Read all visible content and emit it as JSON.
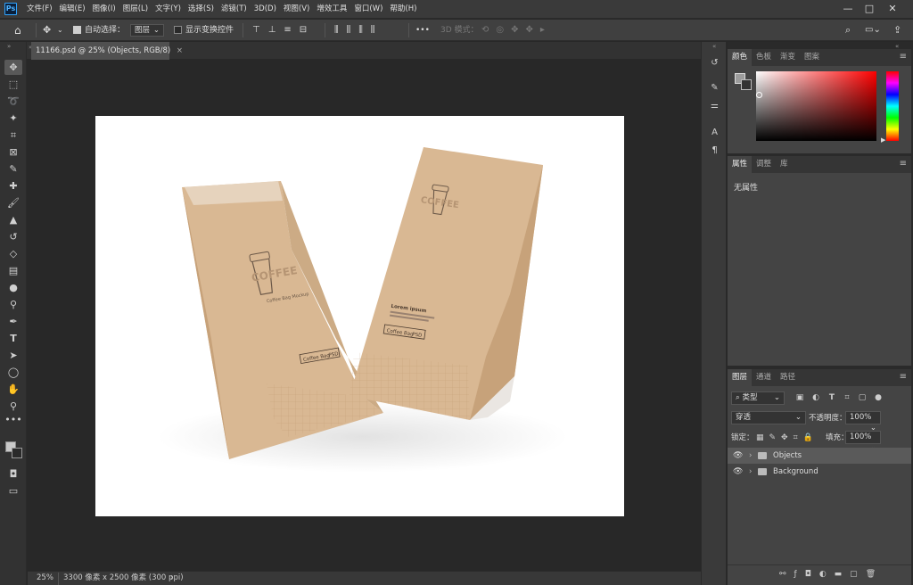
{
  "app": {
    "logo": "Ps"
  },
  "menu": [
    "文件(F)",
    "编辑(E)",
    "图像(I)",
    "图层(L)",
    "文字(Y)",
    "选择(S)",
    "滤镜(T)",
    "3D(D)",
    "视图(V)",
    "增效工具",
    "窗口(W)",
    "帮助(H)"
  ],
  "window_controls": {
    "minimize": "—",
    "maximize": "□",
    "close": "✕"
  },
  "options": {
    "auto_select_label": "自动选择：",
    "auto_select_target": "图层",
    "show_transform_label": "显示变换控件",
    "mode_3d_label": "3D 模式：",
    "more": "•••"
  },
  "document_tab": {
    "title": "11166.psd @ 25% (Objects, RGB/8)",
    "close": "×"
  },
  "status": {
    "zoom": "25%",
    "info": "3300 像素 x 2500 像素 (300 ppi)",
    "arrow": "›"
  },
  "color_panel": {
    "tabs": [
      "颜色",
      "色板",
      "渐变",
      "图案"
    ],
    "active": 0
  },
  "properties_panel": {
    "tabs": [
      "属性",
      "调整",
      "库"
    ],
    "active": 0,
    "body": "无属性"
  },
  "layers_panel": {
    "tabs": [
      "图层",
      "通道",
      "路径"
    ],
    "active": 0,
    "filter_kind": "类型",
    "blend_mode": "穿透",
    "opacity_label": "不透明度：",
    "opacity_value": "100%",
    "lock_label": "锁定：",
    "fill_label": "填充：",
    "fill_value": "100%",
    "layers": [
      {
        "name": "Objects",
        "selected": true
      },
      {
        "name": "Background",
        "selected": false
      }
    ]
  },
  "artwork": {
    "bag_left": {
      "brand": "COFFEE",
      "sub": "Coffee Bag Mockup",
      "tag": "Coffee Bag",
      "badge": "PSD"
    },
    "bag_right": {
      "brand": "COFFEE",
      "heading": "Lorem ipsum",
      "tag": "Coffee Bag",
      "badge": "PSD"
    }
  },
  "colors": {
    "kraft": "#d9b893",
    "kraft_dark": "#c7a27a",
    "ui_bg": "#282828",
    "panel": "#444444",
    "accent": "#2fa4ff"
  }
}
